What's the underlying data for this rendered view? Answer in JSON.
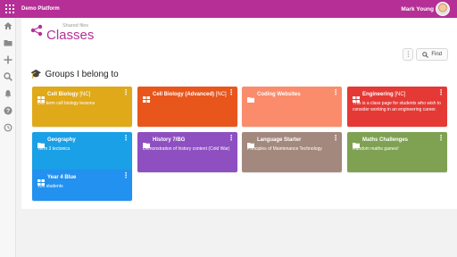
{
  "topbar": {
    "platform_name": "Demo Platform",
    "user_name": "Mark Young",
    "color": "#b52f96"
  },
  "header": {
    "breadcrumb": "Shared files",
    "title": "Classes"
  },
  "toolbar": {
    "menu_label": "⋮",
    "find_label": "Find"
  },
  "section": {
    "title": "Groups I belong to"
  },
  "groups": [
    {
      "name": "Cell Biology",
      "tag": "[NC]",
      "description": "Our term cell biology lessons",
      "color": "#e0a91a",
      "icon": "grid-icon"
    },
    {
      "name": "Cell Biology (Advanced)",
      "tag": "[NC]",
      "description": "",
      "color": "#e8561c",
      "icon": "grid-icon"
    },
    {
      "name": "Coding Websites",
      "tag": "",
      "description": "",
      "color": "#fa8c6c",
      "icon": "folder-icon"
    },
    {
      "name": "Engineering",
      "tag": "[NC]",
      "description": "This is a class page for students who wish to consider working in an engineering career.",
      "color": "#e53935",
      "icon": "grid-icon"
    },
    {
      "name": "Geography",
      "tag": "",
      "description": "Term 3 tectonics",
      "color": "#1aa0e6",
      "icon": "folder-icon"
    },
    {
      "name": "History 7/BG",
      "tag": "",
      "description": "Demonstration of history content (Cold War)",
      "color": "#8e4fc0",
      "icon": "folder-icon"
    },
    {
      "name": "Language Starter",
      "tag": "",
      "description": "Principles of Maintenance Technology",
      "color": "#a3887d",
      "icon": "folder-icon"
    },
    {
      "name": "Maths Challenges",
      "tag": "",
      "description": "Random maths games!",
      "color": "#7ea152",
      "icon": "folder-icon"
    },
    {
      "name": "Year 4 Blue",
      "tag": "",
      "description": "106 students",
      "color": "#2291ef",
      "icon": "grid-icon"
    }
  ]
}
